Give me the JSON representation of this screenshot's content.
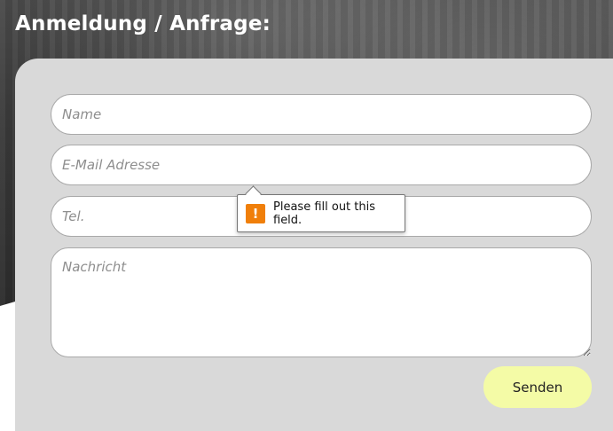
{
  "page": {
    "section_title": "Anmeldung / Anfrage:"
  },
  "form": {
    "name_placeholder": "Name",
    "email_placeholder": "E-Mail Adresse",
    "tel_placeholder": "Tel.",
    "message_placeholder": "Nachricht",
    "submit_label": "Senden"
  },
  "validation": {
    "icon": "warning-icon",
    "icon_glyph": "!",
    "message": "Please fill out this field."
  },
  "colors": {
    "panel_bg": "#d9d9d9",
    "button_bg": "#f4fba6",
    "warning": "#f07f0a"
  }
}
